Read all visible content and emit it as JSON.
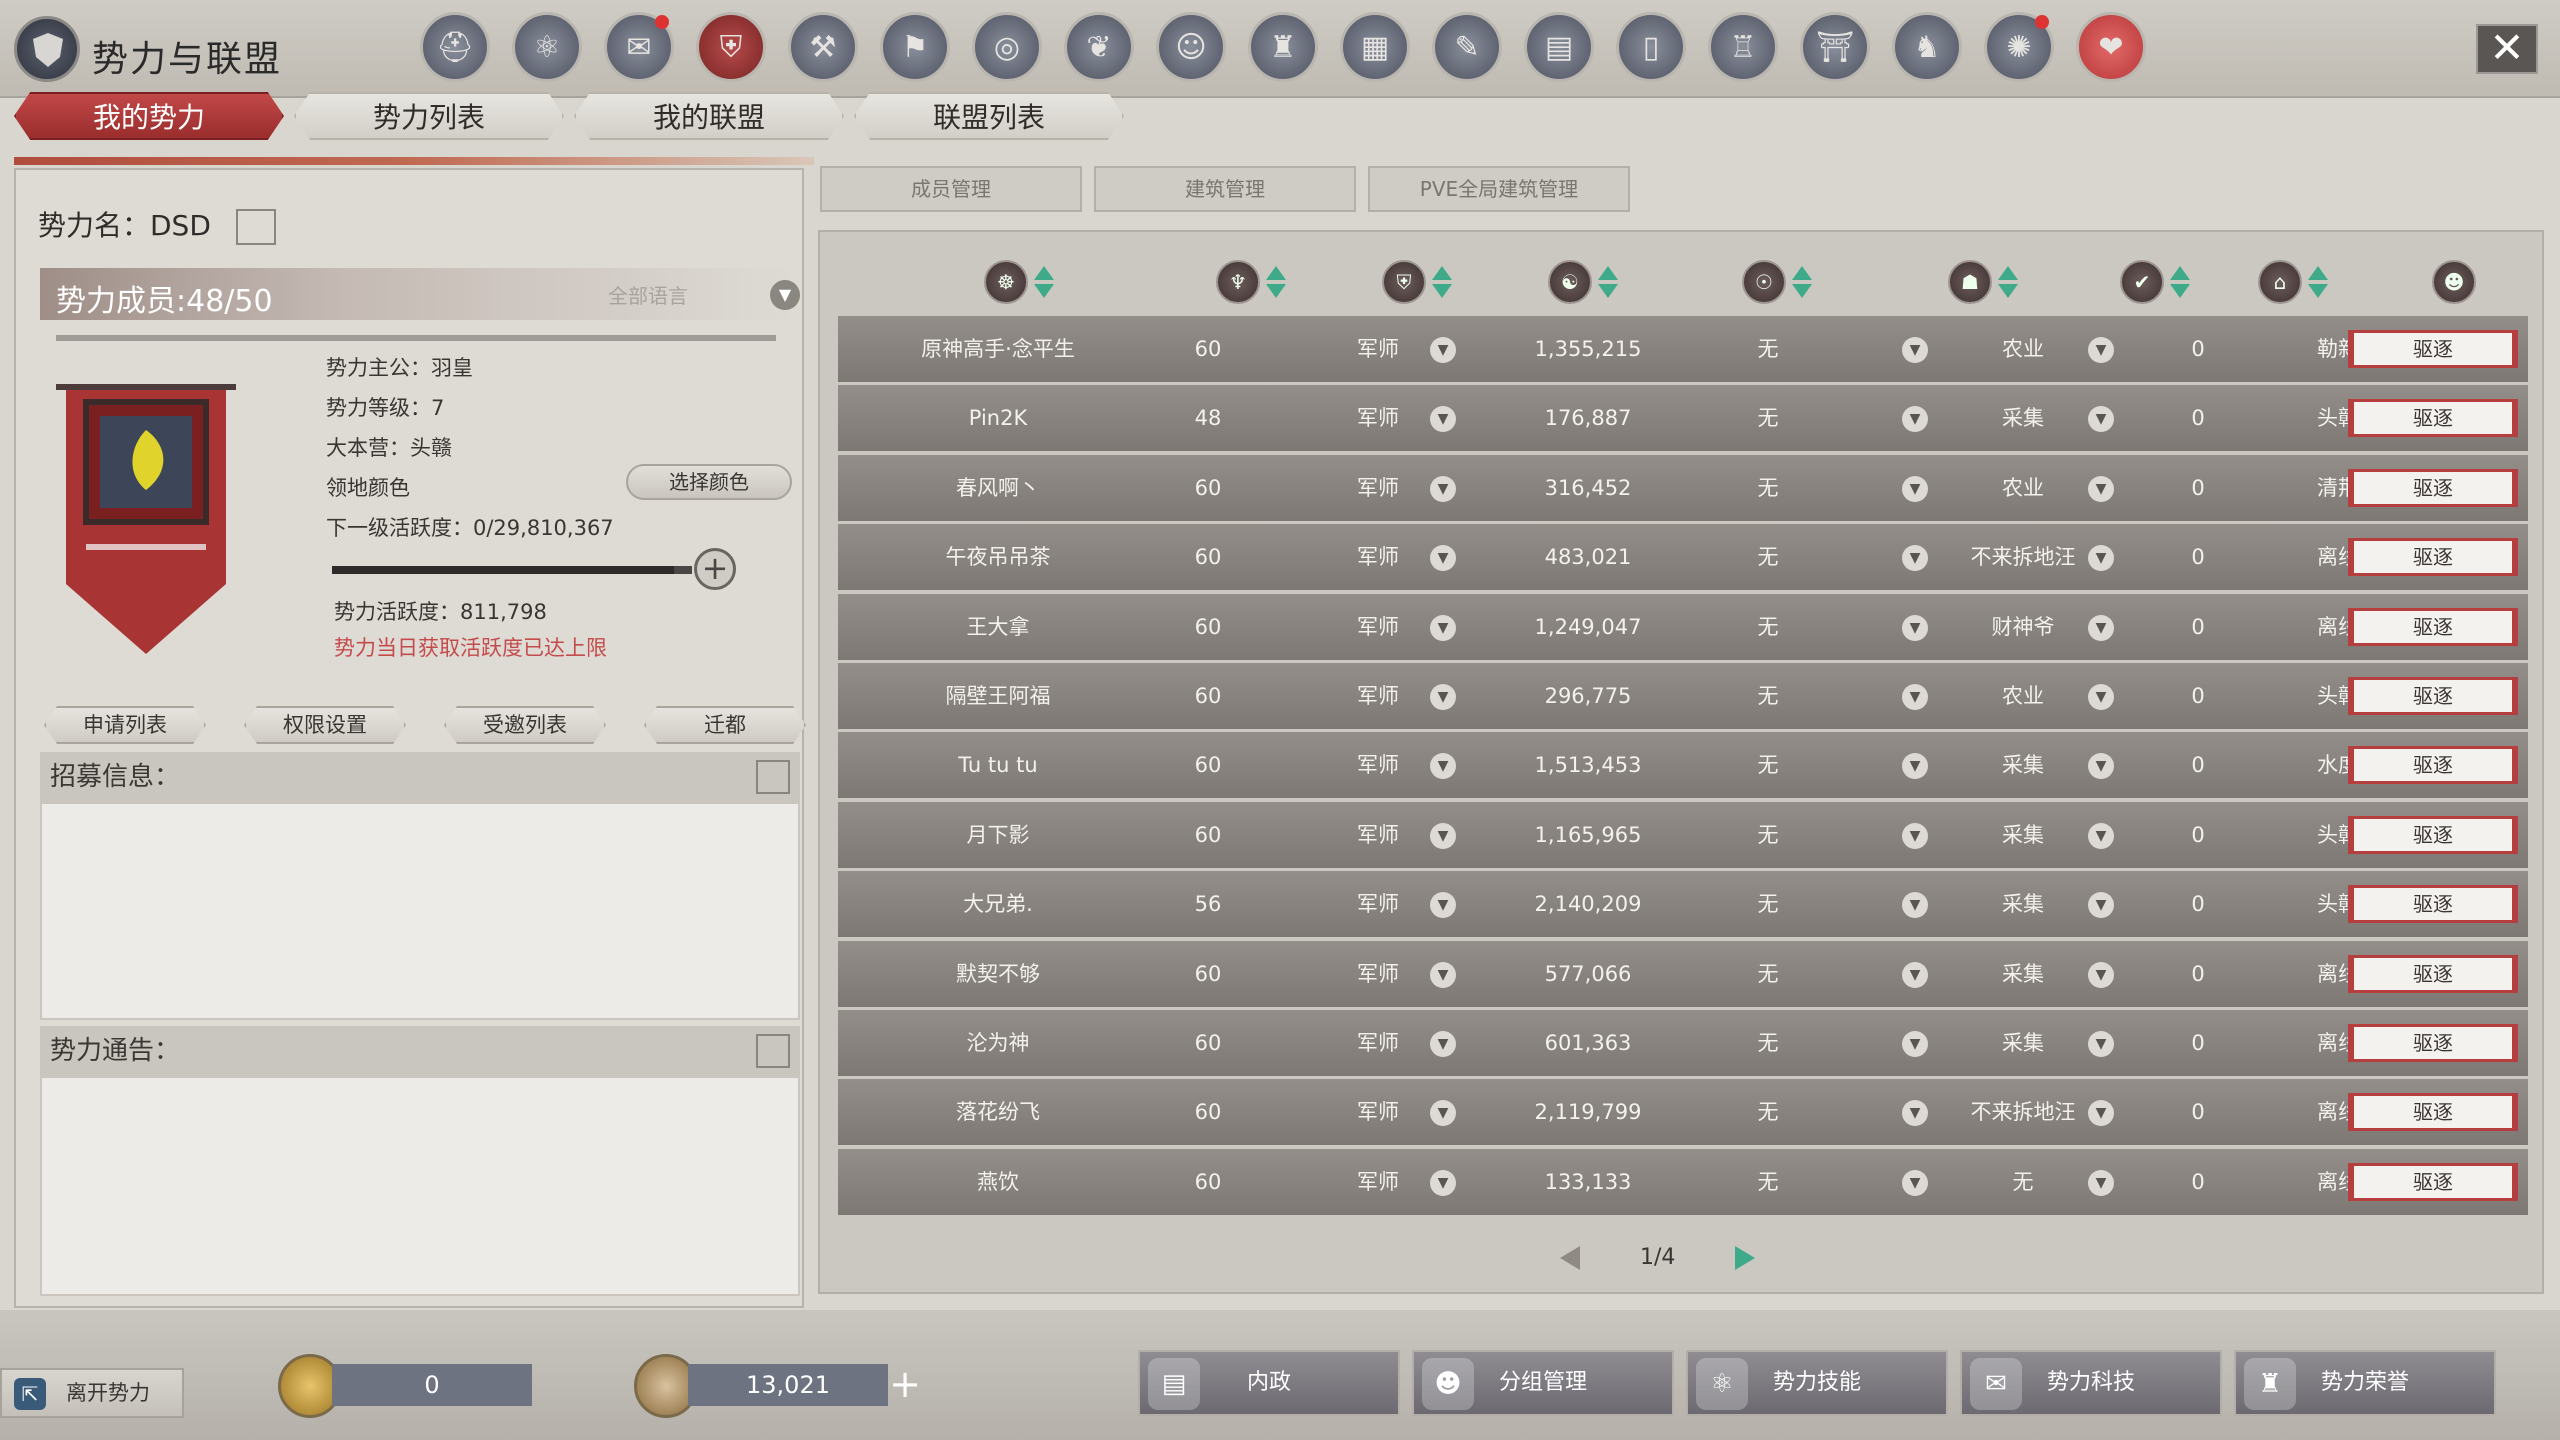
{
  "header": {
    "title": "势力与联盟",
    "icons": [
      "helmet-icon",
      "nodes-icon",
      "scroll-icon",
      "shield-icon",
      "tools-icon",
      "banner-icon",
      "target-icon",
      "dragon-icon",
      "mask-icon",
      "badge-icon",
      "map-icon",
      "quill-icon",
      "book-icon",
      "door-icon",
      "building-icon",
      "altar-icon",
      "beast-icon",
      "compass-icon",
      "heart-book-icon"
    ],
    "close_label": "✕"
  },
  "main_tabs": [
    {
      "label": "我的势力"
    },
    {
      "label": "势力列表"
    },
    {
      "label": "我的联盟"
    },
    {
      "label": "联盟列表"
    }
  ],
  "faction": {
    "name": "势力名：DSD",
    "members": "势力成员:48/50",
    "language": "全部语言",
    "lord": "势力主公：羽皇",
    "level": "势力等级：7",
    "base": "大本营：头赣",
    "territory_color": "领地颜色",
    "select_color": "选择颜色",
    "next_level_activity": "下一级活跃度：0/29,810,367",
    "progress": 0.95,
    "activity": "势力活跃度：811,798",
    "limit_notice": "势力当日获取活跃度已达上限"
  },
  "left_buttons": [
    {
      "label": "申请列表"
    },
    {
      "label": "权限设置"
    },
    {
      "label": "受邀列表"
    },
    {
      "label": "迁都"
    }
  ],
  "recruit_label": "招募信息：",
  "notice_label": "势力通告：",
  "sub_tabs": [
    {
      "label": "成员管理"
    },
    {
      "label": "建筑管理"
    },
    {
      "label": "PVE全局建筑管理"
    }
  ],
  "table_rows": [
    {
      "name": "原神高手·念平生",
      "level": "60",
      "role": "军师",
      "power": "1,355,215",
      "group": "无",
      "job": "农业",
      "zero": "0",
      "loc": "勒新",
      "kick": "驱逐"
    },
    {
      "name": "Pin2K",
      "level": "48",
      "role": "军师",
      "power": "176,887",
      "group": "无",
      "job": "采集",
      "zero": "0",
      "loc": "头赣",
      "kick": "驱逐"
    },
    {
      "name": "春风啊丶",
      "level": "60",
      "role": "军师",
      "power": "316,452",
      "group": "无",
      "job": "农业",
      "zero": "0",
      "loc": "清荆",
      "kick": "驱逐"
    },
    {
      "name": "午夜吊吊茶",
      "level": "60",
      "role": "军师",
      "power": "483,021",
      "group": "无",
      "job": "不来拆地汪",
      "zero": "0",
      "loc": "离线",
      "kick": "驱逐"
    },
    {
      "name": "王大拿",
      "level": "60",
      "role": "军师",
      "power": "1,249,047",
      "group": "无",
      "job": "财神爷",
      "zero": "0",
      "loc": "离线",
      "kick": "驱逐"
    },
    {
      "name": "隔壁王阿福",
      "level": "60",
      "role": "军师",
      "power": "296,775",
      "group": "无",
      "job": "农业",
      "zero": "0",
      "loc": "头赣",
      "kick": "驱逐"
    },
    {
      "name": "Tu tu tu",
      "level": "60",
      "role": "军师",
      "power": "1,513,453",
      "group": "无",
      "job": "采集",
      "zero": "0",
      "loc": "水度",
      "kick": "驱逐"
    },
    {
      "name": "月下影",
      "level": "60",
      "role": "军师",
      "power": "1,165,965",
      "group": "无",
      "job": "采集",
      "zero": "0",
      "loc": "头赣",
      "kick": "驱逐"
    },
    {
      "name": "大兄弟.",
      "level": "56",
      "role": "军师",
      "power": "2,140,209",
      "group": "无",
      "job": "采集",
      "zero": "0",
      "loc": "头赣",
      "kick": "驱逐"
    },
    {
      "name": "默契不够",
      "level": "60",
      "role": "军师",
      "power": "577,066",
      "group": "无",
      "job": "采集",
      "zero": "0",
      "loc": "离线",
      "kick": "驱逐"
    },
    {
      "name": "沦为神",
      "level": "60",
      "role": "军师",
      "power": "601,363",
      "group": "无",
      "job": "采集",
      "zero": "0",
      "loc": "离线",
      "kick": "驱逐"
    },
    {
      "name": "落花纷飞",
      "level": "60",
      "role": "军师",
      "power": "2,119,799",
      "group": "无",
      "job": "不来拆地汪",
      "zero": "0",
      "loc": "离线",
      "kick": "驱逐"
    },
    {
      "name": "燕饮",
      "level": "60",
      "role": "军师",
      "power": "133,133",
      "group": "无",
      "job": "无",
      "zero": "0",
      "loc": "离线",
      "kick": "驱逐"
    }
  ],
  "pager": {
    "label": "1/4"
  },
  "bottom": {
    "leave": "离开势力",
    "currency1": "0",
    "currency2": "13,021",
    "actions": [
      {
        "label": "内政"
      },
      {
        "label": "分组管理"
      },
      {
        "label": "势力技能"
      },
      {
        "label": "势力科技"
      },
      {
        "label": "势力荣誉"
      }
    ]
  }
}
